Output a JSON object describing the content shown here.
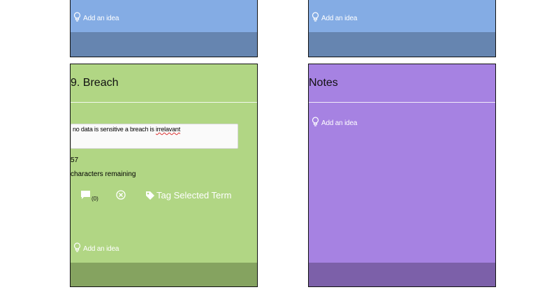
{
  "colors": {
    "blue_panel": "#84ace4",
    "blue_bar": "#6685b0",
    "green_panel": "#b1d684",
    "green_bar": "#85a360",
    "purple_panel": "#a682e2",
    "purple_bar": "#7c60a9"
  },
  "top_panels": [
    {
      "add_idea": "Add an idea"
    },
    {
      "add_idea": "Add an idea"
    }
  ],
  "breach_panel": {
    "title": "9. Breach",
    "note_text_before": "no data is sensitive a breach is ",
    "note_text_misspelled": "irrelavant",
    "chars_count": "57",
    "chars_label": "characters remaining",
    "comment_icon": "comment-icon",
    "comment_count": "(0)",
    "remove_icon": "close-circle-icon",
    "tag_icon": "tag-icon",
    "tag_label": "Tag Selected Term",
    "add_idea": "Add an idea"
  },
  "notes_panel": {
    "title": "Notes",
    "add_idea": "Add an idea"
  }
}
